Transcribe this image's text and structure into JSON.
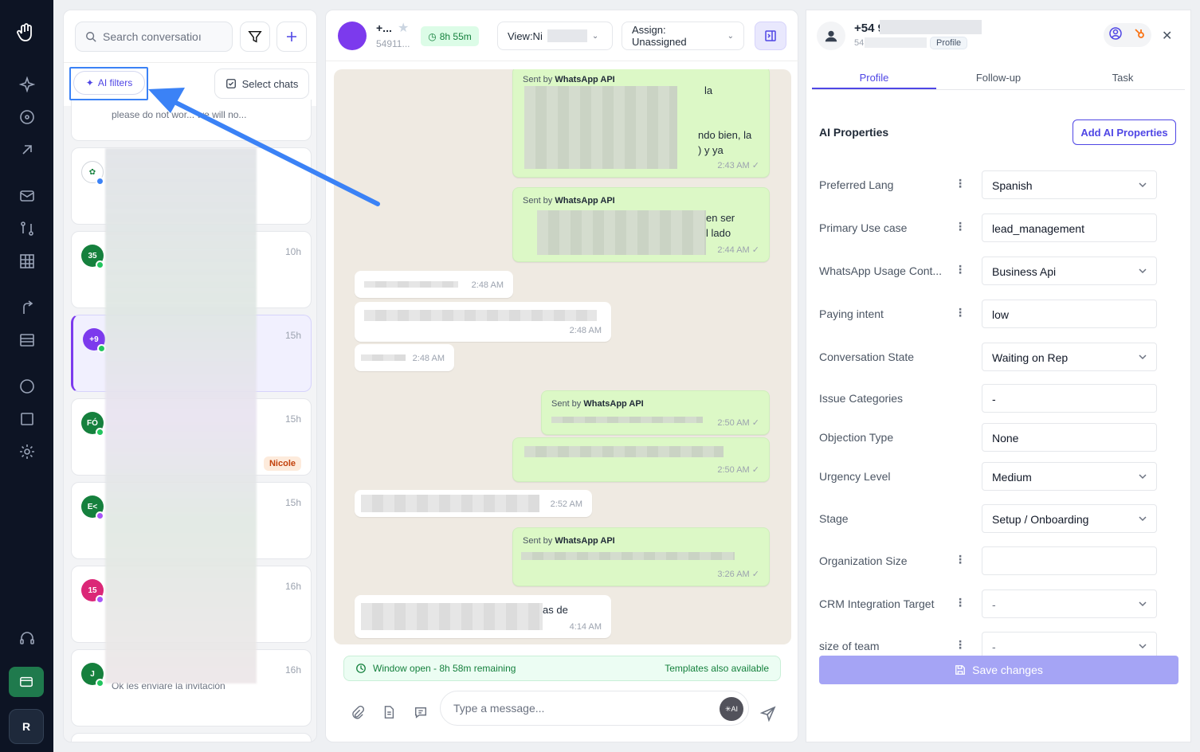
{
  "left": {
    "search_placeholder": "Search conversatioı",
    "ai_filters": "AI filters",
    "select_chats": "Select chats",
    "top_preview": "please do not wor... we will no...",
    "chats": [
      {
        "avatar": "",
        "time": "",
        "preview": "",
        "tag": ""
      },
      {
        "avatar": "35",
        "time": "10h",
        "preview": "",
        "tag": ""
      },
      {
        "avatar": "+9",
        "time": "15h",
        "preview": "",
        "tag": ""
      },
      {
        "avatar": "FÓ",
        "time": "15h",
        "preview": "",
        "tag": "Nicole"
      },
      {
        "avatar": "E<",
        "time": "15h",
        "preview": "",
        "tag": ""
      },
      {
        "avatar": "15",
        "time": "16h",
        "preview": "",
        "tag": ""
      },
      {
        "avatar": "J",
        "time": "16h",
        "preview": "Ok les enviare la invitación",
        "tag": ""
      }
    ]
  },
  "center": {
    "name": "+...",
    "number": "54911...",
    "timer": "8h 55m",
    "view": "View:Ni",
    "assign": "Assign: Unassigned",
    "sent_by_prefix": "Sent by",
    "sent_by_source": "WhatsApp API",
    "messages": [
      {
        "time": "2:43 AM",
        "text": [
          "la",
          "ndo bien, la",
          ") y ya"
        ]
      },
      {
        "time": "2:44 AM",
        "text": [
          "en ser",
          "l lado"
        ]
      },
      {
        "time": "2:48 AM",
        "text": []
      },
      {
        "time": "2:48 AM",
        "text": []
      },
      {
        "time": "2:48 AM",
        "text": []
      },
      {
        "time": "2:50 AM",
        "text": []
      },
      {
        "time": "2:50 AM",
        "text": []
      },
      {
        "time": "2:52 AM",
        "text": []
      },
      {
        "time": "3:26 AM",
        "text": []
      },
      {
        "time": "4:14 AM",
        "text": [
          "as de"
        ]
      }
    ],
    "window_status": "Window open - 8h 58m remaining",
    "templates": "Templates also available",
    "composer_placeholder": "Type a message...",
    "ai_button": "AI"
  },
  "right": {
    "name": "+54 9",
    "number": "54",
    "profile_chip": "Profile",
    "tabs": [
      "Profile",
      "Follow-up",
      "Task"
    ],
    "ai_properties": "AI Properties",
    "add_ai": "Add AI Properties",
    "props": [
      {
        "label": "Preferred Lang",
        "value": "Spanish",
        "dropdown": true
      },
      {
        "label": "Primary Use case",
        "value": "lead_management",
        "dropdown": false
      },
      {
        "label": "WhatsApp Usage Cont...",
        "value": "Business Api",
        "dropdown": true
      },
      {
        "label": "Paying intent",
        "value": "low",
        "dropdown": false
      },
      {
        "label": "Conversation State",
        "value": "Waiting on Rep",
        "dropdown": true
      },
      {
        "label": "Issue Categories",
        "value": "-",
        "dropdown": false
      },
      {
        "label": "Objection Type",
        "value": "None",
        "dropdown": false
      },
      {
        "label": "Urgency Level",
        "value": "Medium",
        "dropdown": true
      },
      {
        "label": "Stage",
        "value": "Setup / Onboarding",
        "dropdown": true
      },
      {
        "label": "Organization Size",
        "value": "",
        "dropdown": false
      },
      {
        "label": "CRM Integration Target",
        "value": "-",
        "dropdown": true
      },
      {
        "label": "size of team",
        "value": "-",
        "dropdown": true
      }
    ],
    "save": "Save changes"
  },
  "nav": {
    "user_initial": "R"
  },
  "colors": {
    "accent": "#4f46e5",
    "annotation": "#3b82f6",
    "whatsapp_green": "#22c55e"
  }
}
